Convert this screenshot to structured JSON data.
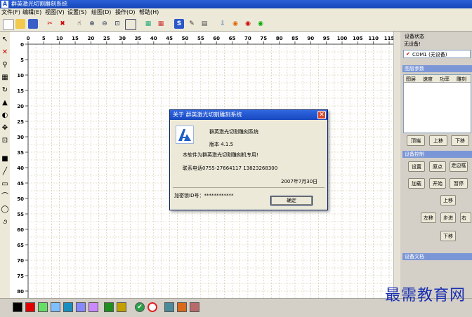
{
  "window": {
    "title": "群英激光切割雕刻系统"
  },
  "menu": [
    "文件(F)",
    "编辑(E)",
    "视图(V)",
    "设置(S)",
    "绘图(D)",
    "操作(O)",
    "帮助(H)"
  ],
  "ruler": {
    "x_labels": [
      "0",
      "5",
      "10",
      "15",
      "20",
      "25",
      "30",
      "35",
      "40",
      "45",
      "50",
      "55",
      "60",
      "65",
      "70",
      "75",
      "80",
      "85",
      "90",
      "95",
      "100",
      "105",
      "110",
      "115"
    ],
    "y_labels": [
      "0",
      "5",
      "10",
      "15",
      "20",
      "25",
      "30",
      "35",
      "40",
      "45",
      "50",
      "55",
      "60",
      "65",
      "70",
      "75",
      "80"
    ]
  },
  "right_panel": {
    "device_status_title": "设备状态",
    "device_status_value": "无设备!",
    "port_label": "COM1 (无设备)",
    "layer_params_title": "图层参数",
    "layer_columns": [
      "图层",
      "速度",
      "功率",
      "雕刻"
    ],
    "layer_buttons": [
      "顶端",
      "上移",
      "下移"
    ],
    "device_control_title": "设备控制",
    "control_row1": [
      "设置",
      "原点",
      "走边框"
    ],
    "control_row2": [
      "加载",
      "开始",
      "暂停"
    ],
    "move": {
      "up": "上移",
      "left": "左移",
      "step": "步进",
      "right": "右移",
      "down": "下移"
    },
    "device_file_title": "设备文档"
  },
  "dialog": {
    "title": "关于 群英激光切割雕刻系统",
    "product": "群英激光切割雕刻系统",
    "version": "版本 4.1.5",
    "license": "本软件为群英激光切割雕刻机专用!",
    "phone": "联系电话0755-27664117   13823268300",
    "date": "2007年7月30日",
    "lock_id": "加密锁ID号：************",
    "ok": "确定"
  },
  "colors": {
    "palette": [
      "#000000",
      "#e00000",
      "#66dd66",
      "#7fbfff",
      "#1a8fbf",
      "#8888ff",
      "#cc88ff",
      "#1f8f1f",
      "#c2a000",
      "#4a8a9a",
      "#d86a1a",
      "#b86a6a"
    ],
    "accent": "#1848c0",
    "grid_line": "#c9c39a"
  },
  "watermark": "最需教育网"
}
